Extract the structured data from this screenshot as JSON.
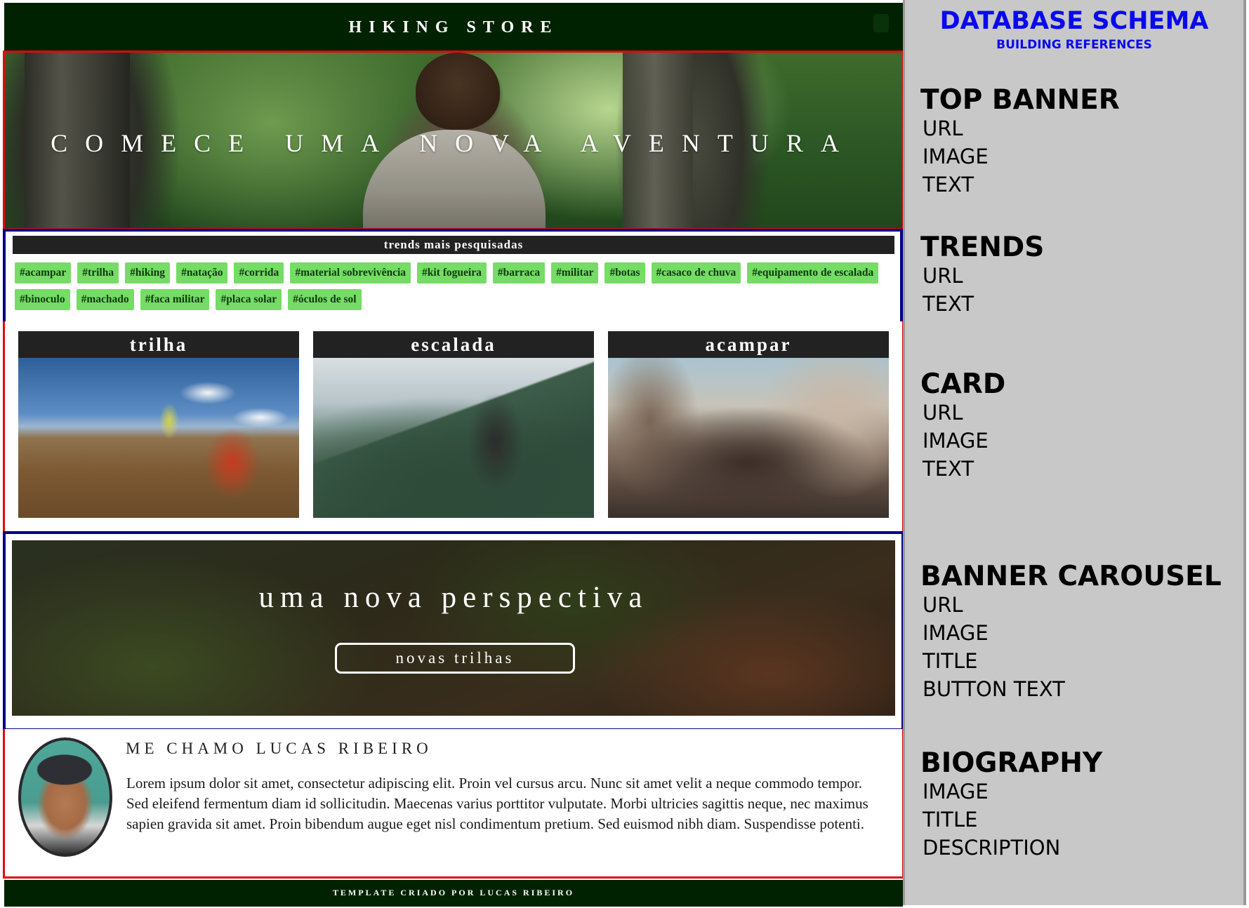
{
  "store": {
    "header_title": "HIKING STORE",
    "top_banner_text": "COMECE UMA NOVA AVENTURA",
    "trends": {
      "title": "trends mais pesquisadas",
      "tags": [
        "#acampar",
        "#trilha",
        "#hiking",
        "#natação",
        "#corrida",
        "#material sobrevivência",
        "#kit fogueira",
        "#barraca",
        "#militar",
        "#botas",
        "#casaco de chuva",
        "#equipamento de escalada",
        "#binoculo",
        "#machado",
        "#faca militar",
        "#placa solar",
        "#óculos de sol"
      ]
    },
    "cards": [
      {
        "title": "trilha",
        "image": "hikers-climbing-rocky-hill"
      },
      {
        "title": "escalada",
        "image": "backpacker-overlooking-mountain-valley"
      },
      {
        "title": "acampar",
        "image": "friends-laughing-in-rocky-mountains"
      }
    ],
    "carousel": {
      "title": "uma nova perspectiva",
      "button_text": "novas trilhas"
    },
    "biography": {
      "title": "ME CHAMO LUCAS RIBEIRO",
      "description": "Lorem ipsum dolor sit amet, consectetur adipiscing elit. Proin vel cursus arcu. Nunc sit amet velit a neque commodo tempor. Sed eleifend fermentum diam id sollicitudin. Maecenas varius porttitor vulputate. Morbi ultricies sagittis neque, nec maximus sapien gravida sit amet. Proin bibendum augue eget nisl condimentum pretium. Sed euismod nibh diam. Suspendisse potenti."
    },
    "footer_text": "TEMPLATE CRIADO POR LUCAS RIBEIRO"
  },
  "schema": {
    "title": "DATABASE SCHEMA",
    "subtitle": "BUILDING REFERENCES",
    "sections": [
      {
        "heading": "TOP BANNER",
        "fields": [
          "URL",
          "IMAGE",
          "TEXT"
        ]
      },
      {
        "heading": "TRENDS",
        "fields": [
          "URL",
          "TEXT"
        ]
      },
      {
        "heading": "CARD",
        "fields": [
          "URL",
          "IMAGE",
          "TEXT"
        ]
      },
      {
        "heading": "BANNER CAROUSEL",
        "fields": [
          "URL",
          "IMAGE",
          "TITLE",
          "BUTTON TEXT"
        ]
      },
      {
        "heading": "BIOGRAPHY",
        "fields": [
          "IMAGE",
          "TITLE",
          "DESCRIPTION"
        ]
      }
    ]
  },
  "colors": {
    "header_bg": "#012201",
    "tag_bg": "#75dc65",
    "section_outline_red": "#e0070f",
    "section_outline_blue": "#020281",
    "schema_title": "#0909ef",
    "schema_bg": "#c8c8c8"
  }
}
